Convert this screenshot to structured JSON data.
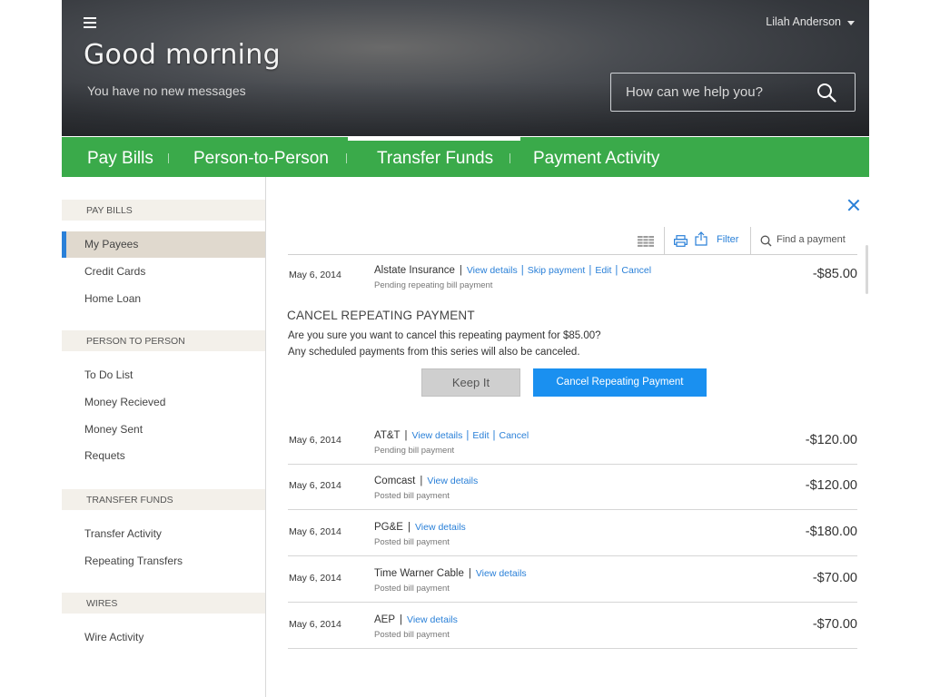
{
  "header": {
    "greeting": "Good morning",
    "messages": "You have no new messages",
    "user_name": "Lilah Anderson",
    "search_placeholder": "How can we help you?"
  },
  "nav": {
    "tabs": [
      {
        "label": "Pay Bills",
        "active": false
      },
      {
        "label": "Person-to-Person",
        "active": false
      },
      {
        "label": "Transfer Funds",
        "active": true
      },
      {
        "label": "Payment Activity",
        "active": false
      }
    ]
  },
  "sidebar": {
    "sections": [
      {
        "title": "PAY BILLS",
        "items": [
          "My Payees",
          "Credit Cards",
          "Home Loan"
        ]
      },
      {
        "title": "PERSON TO PERSON",
        "items": [
          "To Do List",
          "Money Recieved",
          "Money Sent",
          "Requets"
        ]
      },
      {
        "title": "TRANSFER FUNDS",
        "items": [
          "Transfer Activity",
          "Repeating Transfers"
        ]
      },
      {
        "title": "WIRES",
        "items": [
          "Wire Activity"
        ]
      }
    ],
    "selected": "My Payees"
  },
  "toolbar": {
    "filter_label": "Filter",
    "find_label": "Find a payment"
  },
  "cancel_panel": {
    "title": "CANCEL REPEATING PAYMENT",
    "question": "Are you sure you want to cancel this repeating payment for  $85.00?",
    "note": "Any scheduled payments from this series will also be canceled.",
    "keep_label": "Keep It",
    "confirm_label": "Cancel Repeating Payment"
  },
  "payments": [
    {
      "date": "May 6, 2014",
      "payee": "Alstate Insurance",
      "links": [
        "View details",
        "Skip payment",
        "Edit",
        "Cancel"
      ],
      "status": "Pending repeating bill payment",
      "amount": "-$85.00"
    },
    {
      "date": "May 6, 2014",
      "payee": "AT&T",
      "links": [
        "View details",
        "Edit",
        "Cancel"
      ],
      "status": "Pending bill payment",
      "amount": "-$120.00"
    },
    {
      "date": "May 6, 2014",
      "payee": "Comcast",
      "links": [
        "View details"
      ],
      "status": "Posted bill payment",
      "amount": "-$120.00"
    },
    {
      "date": "May 6, 2014",
      "payee": "PG&E",
      "links": [
        "View details"
      ],
      "status": "Posted bill payment",
      "amount": "-$180.00"
    },
    {
      "date": "May 6, 2014",
      "payee": "Time Warner Cable",
      "links": [
        "View details"
      ],
      "status": "Posted bill payment",
      "amount": "-$70.00"
    },
    {
      "date": "May 6, 2014",
      "payee": "AEP",
      "links": [
        "View details"
      ],
      "status": "Posted bill payment",
      "amount": "-$70.00"
    }
  ],
  "colors": {
    "accent_green": "#3aaa4a",
    "link_blue": "#2a80d8",
    "primary_button": "#1a90f0"
  }
}
